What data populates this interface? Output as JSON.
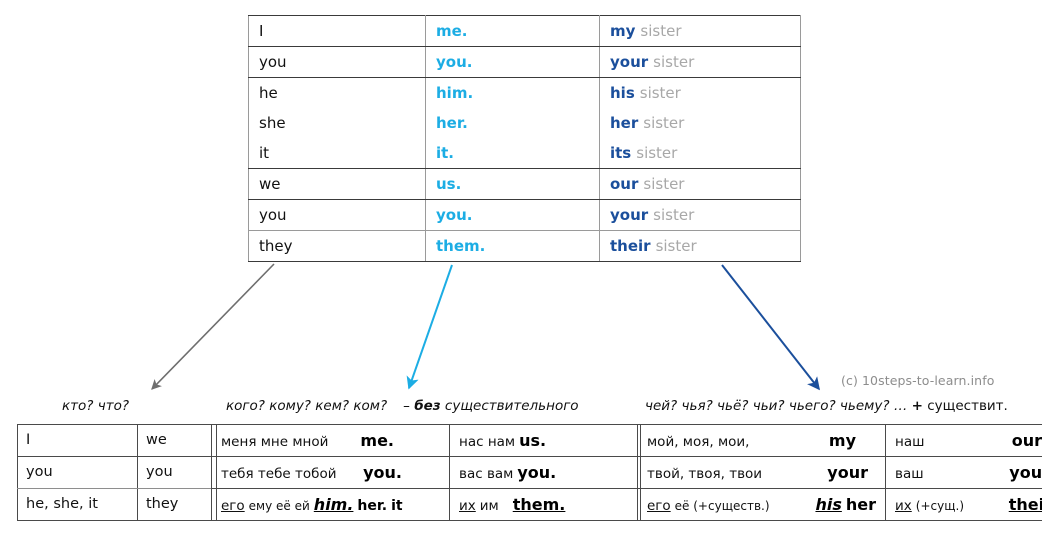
{
  "credit": "(c) 10steps-to-learn.info",
  "colors": {
    "object_cyan": "#1cade4",
    "possessive_blue": "#1b4f9c",
    "sister_gray": "#a8a8a8",
    "arrow_gray": "#6e6e6e",
    "arrow_cyan": "#1cade4",
    "arrow_blue": "#1b4f9c"
  },
  "main_table": {
    "rows": [
      {
        "subject": "I",
        "object": "me.",
        "possessive": "my",
        "noun": "sister"
      },
      {
        "subject": "you",
        "object": "you.",
        "possessive": "your",
        "noun": "sister"
      },
      {
        "subject": "he",
        "object": "him.",
        "possessive": "his",
        "noun": "sister"
      },
      {
        "subject": "she",
        "object": "her.",
        "possessive": "her",
        "noun": "sister"
      },
      {
        "subject": "it",
        "object": "it.",
        "possessive": "its",
        "noun": "sister"
      },
      {
        "subject": "we",
        "object": "us.",
        "possessive": "our",
        "noun": "sister"
      },
      {
        "subject": "you",
        "object": "you.",
        "possessive": "your",
        "noun": "sister"
      },
      {
        "subject": "they",
        "object": "them.",
        "possessive": "their",
        "noun": "sister"
      }
    ]
  },
  "subject_section": {
    "caption": "кто? что?",
    "rows": [
      {
        "singular": "I",
        "plural": "we"
      },
      {
        "singular": "you",
        "plural": "you"
      },
      {
        "singular": "he, she, it",
        "plural": "they"
      }
    ]
  },
  "object_section": {
    "caption_questions": "кого? кому? кем? ком?",
    "caption_dash": "–",
    "caption_bold": "без",
    "caption_tail": "существительного",
    "rows": [
      {
        "sg_ru": "меня мне мной",
        "sg_en": "me.",
        "pl_ru": "нас нам",
        "pl_en": "us."
      },
      {
        "sg_ru": "тебя тебе тобой",
        "sg_en": "you.",
        "pl_ru": "вас вам",
        "pl_en": "you."
      },
      {
        "sg_ru_underlined": "его",
        "sg_ru_rest": "ему её ей",
        "sg_en_1": "him.",
        "sg_en_2": "her.",
        "sg_en_3": "it",
        "pl_ru_underlined": "их",
        "pl_ru_rest": "им",
        "pl_en": "them."
      }
    ]
  },
  "possessive_section": {
    "caption_questions": "чей? чья? чьё? чьи? чьего? чьему?",
    "caption_ellipsis": "…",
    "caption_plus": "+",
    "caption_tail": "существит.",
    "rows": [
      {
        "sg_ru": "мой, моя, мои,",
        "sg_en": "my",
        "pl_ru": "наш",
        "pl_en": "our"
      },
      {
        "sg_ru": "твой, твоя, твои",
        "sg_en": "your",
        "pl_ru": "ваш",
        "pl_en": "your"
      },
      {
        "sg_ru_underlined": "его",
        "sg_ru_rest": "её (+существ.)",
        "sg_en_1": "his",
        "sg_en_2": "her",
        "pl_ru_underlined": "их",
        "pl_ru_rest": "(+сущ.)",
        "pl_en": "their"
      }
    ]
  }
}
